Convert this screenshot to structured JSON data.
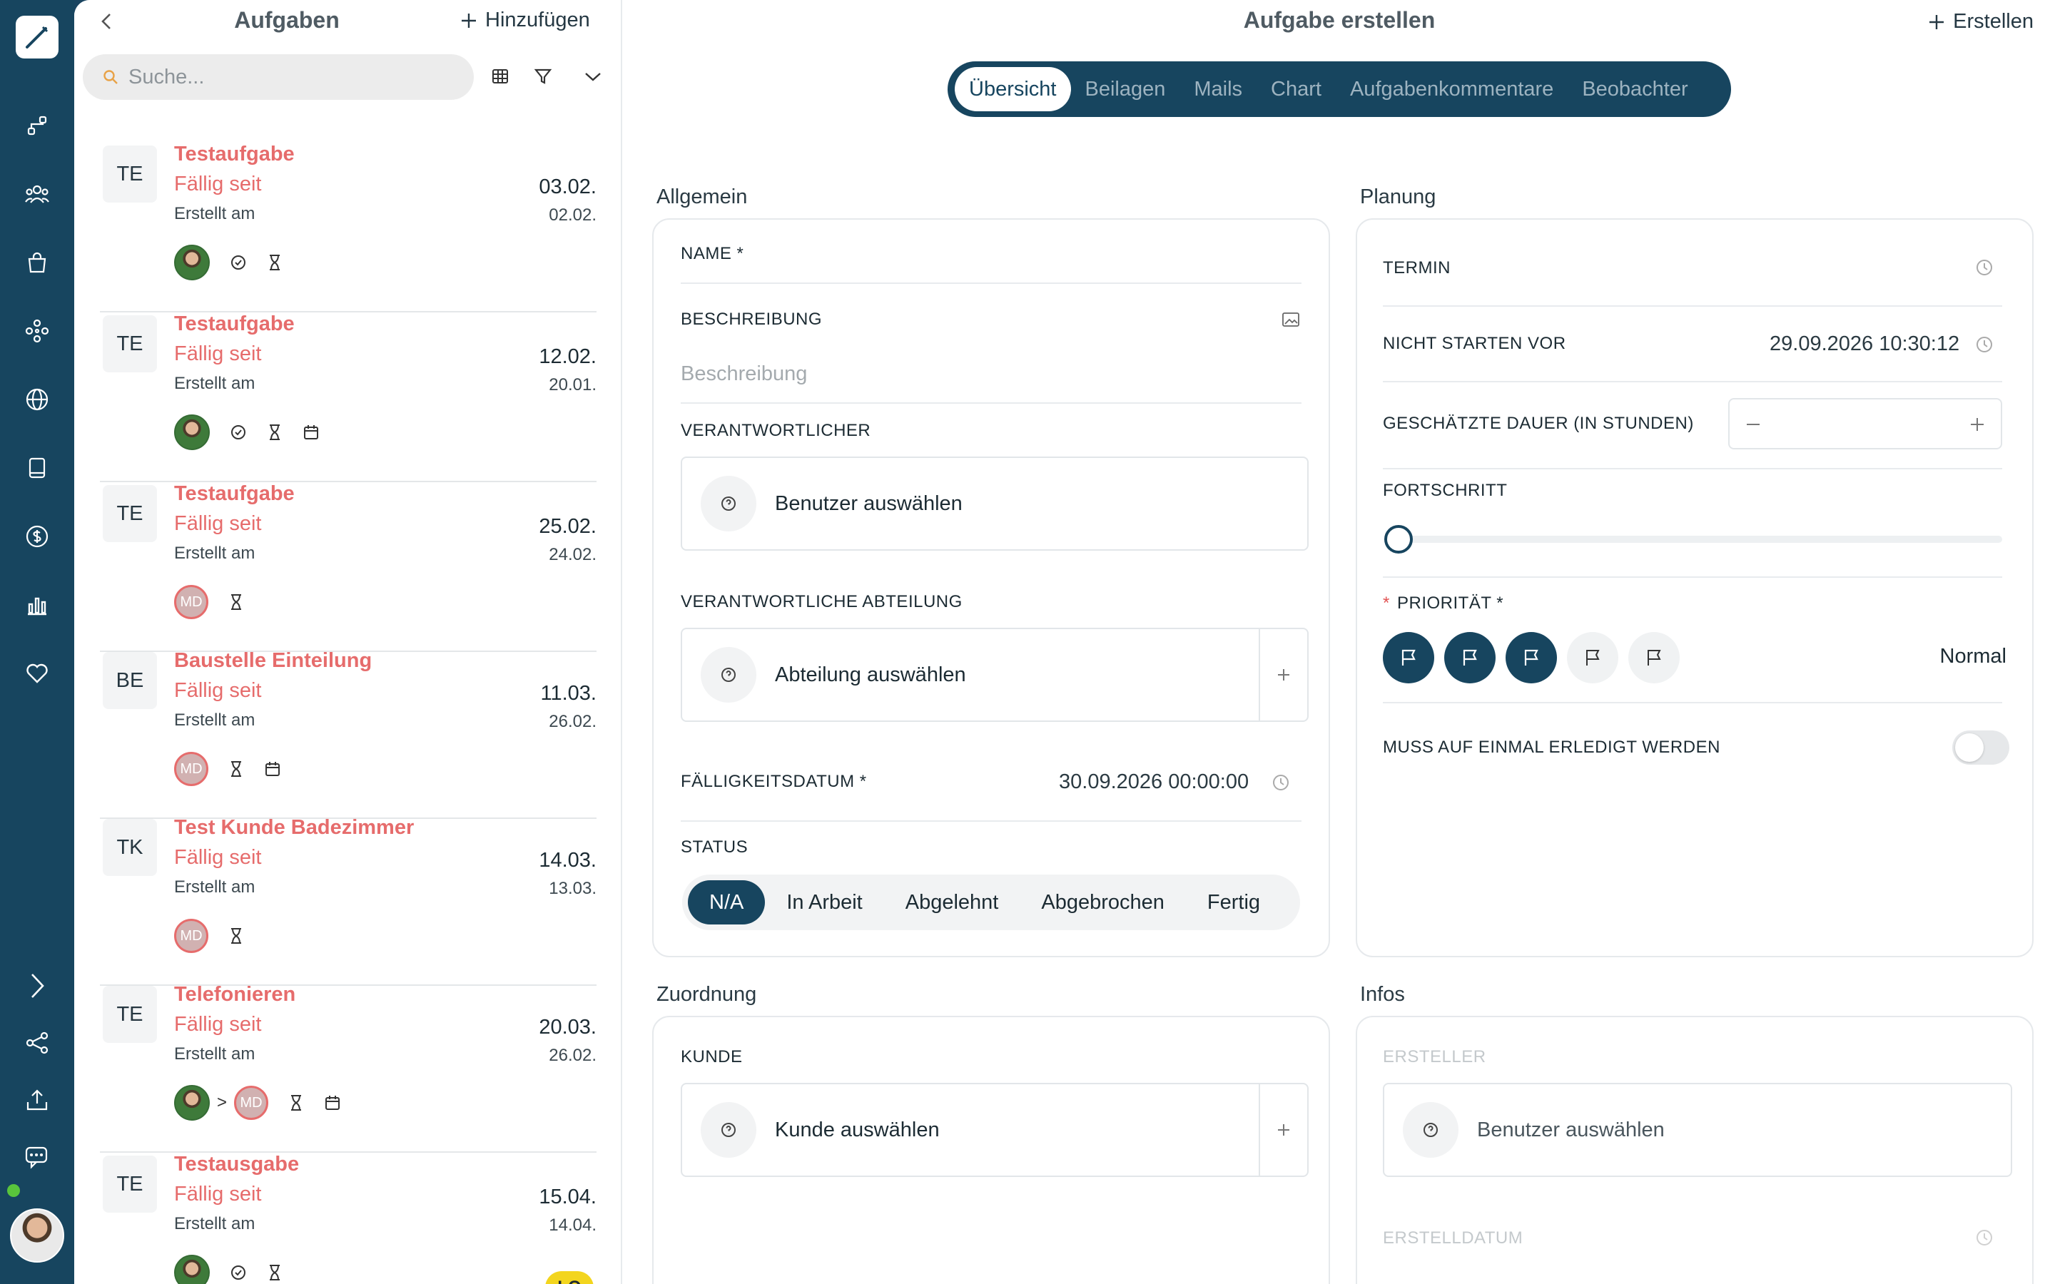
{
  "list": {
    "title": "Aufgaben",
    "add_label": "Hinzufügen",
    "search_placeholder": "Suche...",
    "tasks": [
      {
        "badge": "TE",
        "title": "Testaufgabe",
        "due_label": "Fällig seit",
        "created_label": "Erstellt am",
        "due_date": "03.02.",
        "created_date": "02.02."
      },
      {
        "badge": "TE",
        "title": "Testaufgabe",
        "due_label": "Fällig seit",
        "created_label": "Erstellt am",
        "due_date": "12.02.",
        "created_date": "20.01."
      },
      {
        "badge": "TE",
        "title": "Testaufgabe",
        "due_label": "Fällig seit",
        "created_label": "Erstellt am",
        "due_date": "25.02.",
        "created_date": "24.02.",
        "assignee": "MD"
      },
      {
        "badge": "BE",
        "title": "Baustelle Einteilung",
        "due_label": "Fällig seit",
        "created_label": "Erstellt am",
        "due_date": "11.03.",
        "created_date": "26.02.",
        "assignee": "MD"
      },
      {
        "badge": "TK",
        "title": "Test Kunde Badezimmer",
        "due_label": "Fällig seit",
        "created_label": "Erstellt am",
        "due_date": "14.03.",
        "created_date": "13.03.",
        "assignee": "MD"
      },
      {
        "badge": "TE",
        "title": "Telefonieren",
        "due_label": "Fällig seit",
        "created_label": "Erstellt am",
        "due_date": "20.03.",
        "created_date": "26.02.",
        "assignee": "MD",
        "arrow": ">"
      },
      {
        "badge": "TE",
        "title": "Testausgabe",
        "due_label": "Fällig seit",
        "created_label": "Erstellt am",
        "due_date": "15.04.",
        "created_date": "14.04.",
        "tag": "LO"
      }
    ]
  },
  "main": {
    "title": "Aufgabe erstellen",
    "create_label": "Erstellen",
    "tabs": [
      "Übersicht",
      "Beilagen",
      "Mails",
      "Chart",
      "Aufgabenkommentare",
      "Beobachter"
    ],
    "active_tab": "Übersicht",
    "allgemein": {
      "section": "Allgemein",
      "name_label": "NAME *",
      "desc_label": "BESCHREIBUNG",
      "desc_placeholder": "Beschreibung",
      "responsible_label": "VERANTWORTLICHER",
      "responsible_value": "Benutzer auswählen",
      "dept_label": "VERANTWORTLICHE ABTEILUNG",
      "dept_value": "Abteilung auswählen",
      "due_label": "FÄLLIGKEITSDATUM *",
      "due_value": "30.09.2026 00:00:00",
      "status_label": "STATUS",
      "status_options": [
        "N/A",
        "In Arbeit",
        "Abgelehnt",
        "Abgebrochen",
        "Fertig"
      ],
      "status_active": "N/A"
    },
    "planung": {
      "section": "Planung",
      "termin_label": "TERMIN",
      "not_before_label": "NICHT STARTEN VOR",
      "not_before_value": "29.09.2026 10:30:12",
      "duration_label": "GESCHÄTZTE DAUER (IN STUNDEN)",
      "progress_label": "FORTSCHRITT",
      "progress_value": 0,
      "priority_star": "*",
      "priority_label": "PRIORITÄT *",
      "priority_level": 3,
      "priority_max": 5,
      "priority_value": "Normal",
      "once_label": "MUSS AUF EINMAL ERLEDIGT WERDEN",
      "once_on": false
    },
    "zuordnung": {
      "section": "Zuordnung",
      "customer_label": "KUNDE",
      "customer_value": "Kunde auswählen"
    },
    "infos": {
      "section": "Infos",
      "creator_label": "ERSTELLER",
      "creator_value": "Benutzer auswählen",
      "created_date_label": "ERSTELLDATUM"
    }
  },
  "colors": {
    "navy": "#17455f",
    "accent_red": "#e66c6c",
    "tag_yellow": "#f3d51e"
  }
}
